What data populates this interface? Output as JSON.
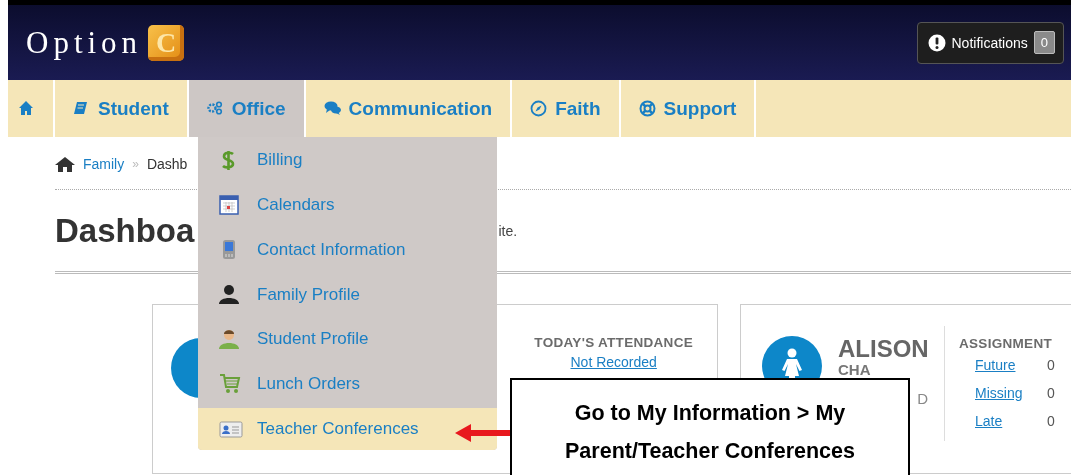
{
  "header": {
    "logo_text": "Option",
    "logo_block_letter": "C",
    "notifications": {
      "label": "Notifications",
      "count": "0"
    }
  },
  "nav": {
    "tabs": [
      {
        "kind": "icon",
        "selected": false
      },
      {
        "kind": "text",
        "label": "Student",
        "selected": false
      },
      {
        "kind": "text",
        "label": "Office",
        "selected": true
      },
      {
        "kind": "text",
        "label": "Communication",
        "selected": false
      },
      {
        "kind": "text",
        "label": "Faith",
        "selected": false
      },
      {
        "kind": "text",
        "label": "Support",
        "selected": false
      }
    ]
  },
  "dropdown": {
    "items": [
      {
        "label": "Billing",
        "selected": false
      },
      {
        "label": "Calendars",
        "selected": false
      },
      {
        "label": "Contact Information",
        "selected": false
      },
      {
        "label": "Family Profile",
        "selected": false
      },
      {
        "label": "Student Profile",
        "selected": false
      },
      {
        "label": "Lunch Orders",
        "selected": false
      },
      {
        "label": "Teacher Conferences",
        "selected": true
      }
    ]
  },
  "breadcrumb": {
    "items": [
      "Family",
      "Dashb"
    ],
    "separator": "»"
  },
  "page_title": "Dashboa",
  "welcome_text": "ite.",
  "student_cards": [
    {
      "attendance": {
        "heading": "TODAY'S ATTENDANCE",
        "value": "Not Recorded"
      }
    },
    {
      "first_name": "ALISON",
      "last_name": "CHA",
      "detail": "D",
      "assignments": {
        "heading": "ASSIGNMENT",
        "rows": [
          {
            "label": "Future",
            "count": "0"
          },
          {
            "label": "Missing",
            "count": "0"
          },
          {
            "label": "Late",
            "count": "0"
          }
        ]
      }
    }
  ],
  "callout": {
    "text": "Go to My Information > My Parent/Teacher Conferences"
  }
}
